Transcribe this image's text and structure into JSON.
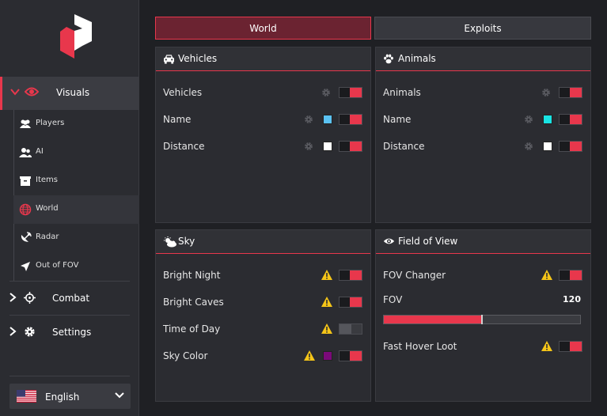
{
  "sidebar": {
    "visuals_label": "Visuals",
    "sub_items": [
      {
        "label": "Players",
        "icon": "users-icon"
      },
      {
        "label": "AI",
        "icon": "user-group-icon"
      },
      {
        "label": "Items",
        "icon": "box-icon"
      },
      {
        "label": "World",
        "icon": "globe-icon",
        "active": true
      },
      {
        "label": "Radar",
        "icon": "satellite-icon"
      },
      {
        "label": "Out of FOV",
        "icon": "location-arrow-icon"
      }
    ],
    "combat_label": "Combat",
    "settings_label": "Settings",
    "language": "English"
  },
  "tabs": {
    "world": "World",
    "exploits": "Exploits"
  },
  "panels": {
    "vehicles": {
      "title": "Vehicles",
      "rows": [
        {
          "label": "Vehicles",
          "enabled": true
        },
        {
          "label": "Name",
          "color": "#5bc2f2",
          "enabled": true
        },
        {
          "label": "Distance",
          "color": "#ffffff",
          "enabled": true
        }
      ]
    },
    "animals": {
      "title": "Animals",
      "rows": [
        {
          "label": "Animals",
          "enabled": true
        },
        {
          "label": "Name",
          "color": "#19e3e3",
          "enabled": true
        },
        {
          "label": "Distance",
          "color": "#ffffff",
          "enabled": true
        }
      ]
    },
    "sky": {
      "title": "Sky",
      "rows": [
        {
          "label": "Bright Night",
          "enabled": true
        },
        {
          "label": "Bright Caves",
          "enabled": true
        },
        {
          "label": "Time of Day",
          "enabled": false
        },
        {
          "label": "Sky Color",
          "color": "#7a0a7a",
          "enabled": true
        }
      ]
    },
    "fov": {
      "title": "Field of View",
      "changer_label": "FOV Changer",
      "changer_enabled": true,
      "slider_label": "FOV",
      "slider_value": "120",
      "slider_fraction": 0.5,
      "hover_label": "Fast Hover Loot",
      "hover_enabled": true
    }
  },
  "colors": {
    "accent": "#e8374c",
    "background": "#1f2024",
    "panel": "#2b2c31",
    "warning": "#f5c518"
  }
}
